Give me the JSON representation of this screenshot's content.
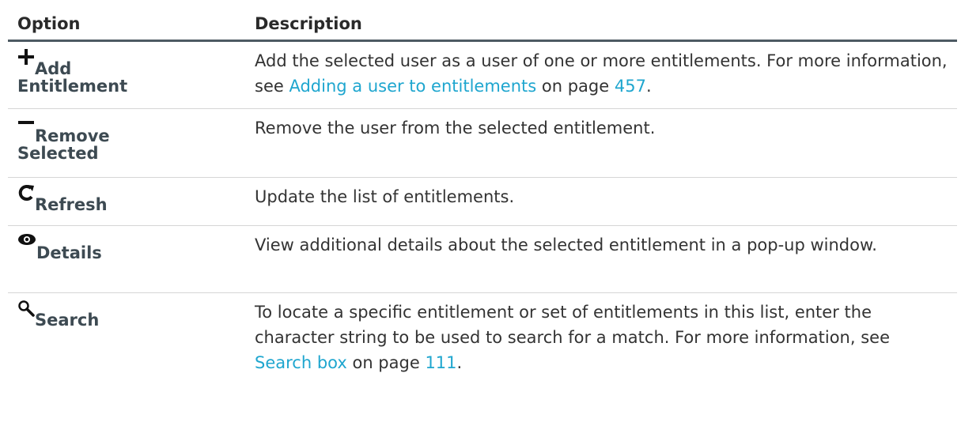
{
  "header": {
    "option": "Option",
    "description": "Description"
  },
  "rows": [
    {
      "icon": "plus-icon",
      "label_line1": "Add",
      "label_line2": "Entitlement",
      "desc_before": "Add the selected user as a user of one or more entitlements. For more information, see ",
      "link1": "Adding a user to entitlements",
      "desc_mid": " on page ",
      "link2": "457",
      "desc_after": "."
    },
    {
      "icon": "minus-icon",
      "label_line1": "Remove",
      "label_line2": "Selected",
      "desc": "Remove the user from the selected entitlement."
    },
    {
      "icon": "refresh-icon",
      "label_line1": "Refresh",
      "desc": "Update the list of entitlements."
    },
    {
      "icon": "eye-icon",
      "label_line1": "Details",
      "desc": "View additional details about the selected entitlement in a pop-up window."
    },
    {
      "icon": "search-icon",
      "label_line1": "Search",
      "desc_before": "To locate a specific entitlement or set of entitlements in this list, enter the character string to be used to search for a match. For more information, see ",
      "link1": "Search box",
      "desc_mid": " on page ",
      "link2": "111",
      "desc_after": "."
    }
  ],
  "colors": {
    "link": "#1fa6cf",
    "header_rule": "#4d5a63",
    "row_rule": "#d6d6d6"
  }
}
